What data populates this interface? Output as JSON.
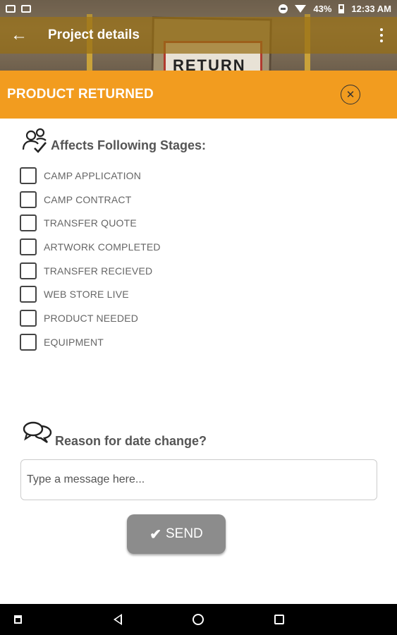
{
  "status_bar": {
    "battery": "43%",
    "time": "12:33 AM"
  },
  "app_bar": {
    "title": "Project details",
    "back_icon": "arrow-left-icon",
    "overflow_icon": "more-vert-icon"
  },
  "background_sign": {
    "text": "RETURN"
  },
  "dialog": {
    "title": "PRODUCT RETURNED",
    "close_icon": "close-circle-icon",
    "header_color": "#f29c1f"
  },
  "stages": {
    "heading": "Affects Following Stages:",
    "icon": "users-check-icon",
    "items": [
      {
        "label": "CAMP APPLICATION",
        "checked": false
      },
      {
        "label": "CAMP CONTRACT",
        "checked": false
      },
      {
        "label": "TRANSFER QUOTE",
        "checked": false
      },
      {
        "label": "ARTWORK COMPLETED",
        "checked": false
      },
      {
        "label": "TRANSFER RECIEVED",
        "checked": false
      },
      {
        "label": "WEB STORE LIVE",
        "checked": false
      },
      {
        "label": "PRODUCT NEEDED",
        "checked": false
      },
      {
        "label": "EQUIPMENT",
        "checked": false
      }
    ]
  },
  "reason": {
    "heading": "Reason for date change?",
    "icon": "chat-bubbles-icon",
    "placeholder": "Type a message here...",
    "value": ""
  },
  "send_button": {
    "label": "SEND",
    "icon": "check-icon",
    "color": "#8c8c8c"
  }
}
